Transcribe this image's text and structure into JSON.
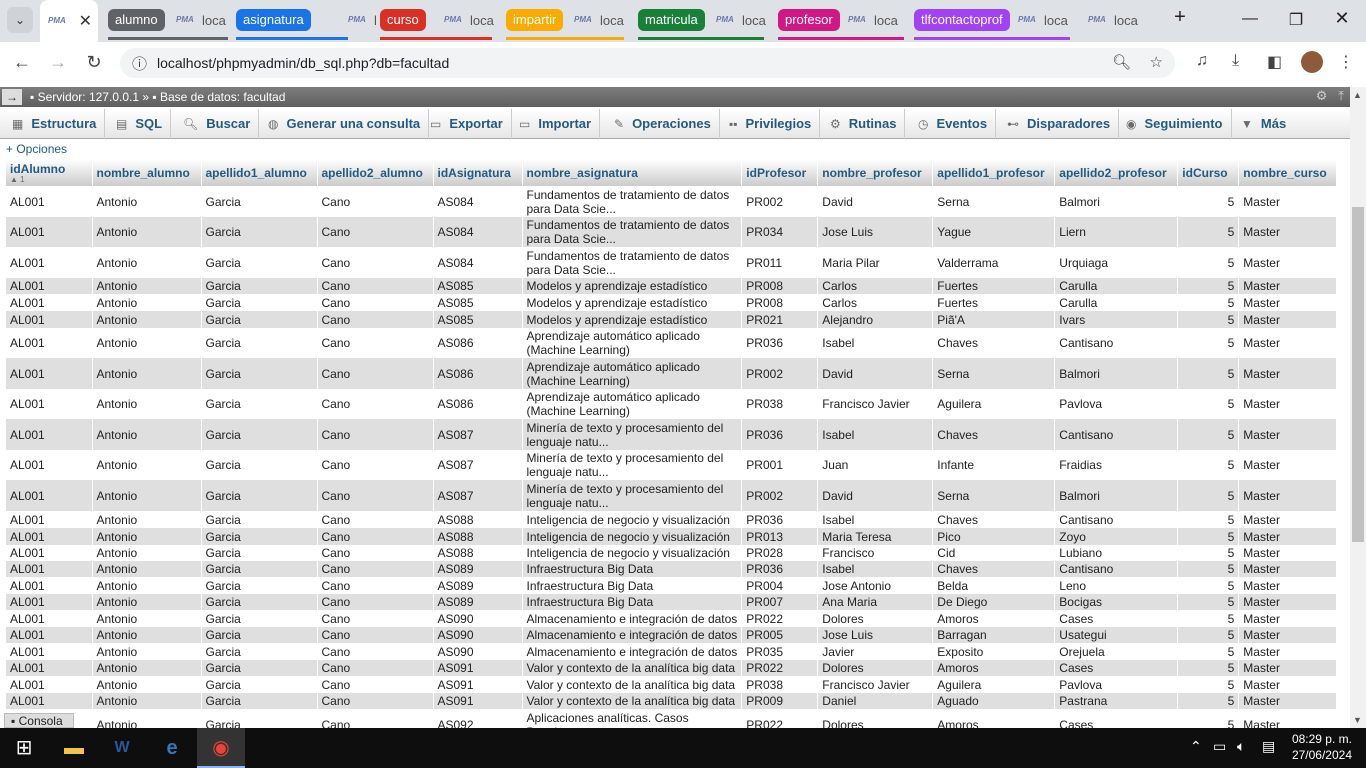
{
  "browser": {
    "tabs": [
      {
        "kind": "tab",
        "label": "",
        "active": true
      },
      {
        "kind": "group",
        "label": "alumno",
        "color": "#5f6368"
      },
      {
        "kind": "tab",
        "label": "loca"
      },
      {
        "kind": "group",
        "label": "asignatura",
        "color": "#1a73e8"
      },
      {
        "kind": "tab",
        "label": "loca"
      },
      {
        "kind": "group",
        "label": "curso",
        "color": "#d93025"
      },
      {
        "kind": "tab",
        "label": "loca"
      },
      {
        "kind": "group",
        "label": "impartir",
        "color": "#f9ab00"
      },
      {
        "kind": "tab",
        "label": "loca"
      },
      {
        "kind": "group",
        "label": "matricula",
        "color": "#188038"
      },
      {
        "kind": "tab",
        "label": "loca"
      },
      {
        "kind": "group",
        "label": "profesor",
        "color": "#d01884"
      },
      {
        "kind": "tab",
        "label": "loca"
      },
      {
        "kind": "group",
        "label": "tlfcontactoprof",
        "color": "#a142f4"
      },
      {
        "kind": "tab",
        "label": "loca"
      },
      {
        "kind": "tab",
        "label": "loca"
      }
    ],
    "favicon_text": "PMA",
    "url": "localhost/phpmyadmin/db_sql.php?db=facultad"
  },
  "pma": {
    "breadcrumb_server": "Servidor: 127.0.0.1 »",
    "breadcrumb_db": "Base de datos: facultad",
    "menu": [
      {
        "label": "Estructura",
        "icon": "structure-icon"
      },
      {
        "label": "SQL",
        "icon": "sql-icon"
      },
      {
        "label": "Buscar",
        "icon": "search-icon"
      },
      {
        "label": "Generar una consulta",
        "icon": "query-icon"
      },
      {
        "label": "Exportar",
        "icon": "export-icon"
      },
      {
        "label": "Importar",
        "icon": "import-icon"
      },
      {
        "label": "Operaciones",
        "icon": "wrench-icon"
      },
      {
        "label": "Privilegios",
        "icon": "privileges-icon"
      },
      {
        "label": "Rutinas",
        "icon": "routines-icon"
      },
      {
        "label": "Eventos",
        "icon": "clock-icon"
      },
      {
        "label": "Disparadores",
        "icon": "trigger-icon"
      },
      {
        "label": "Seguimiento",
        "icon": "eye-icon"
      },
      {
        "label": "Más",
        "icon": "chevron-down-icon"
      }
    ],
    "options_label": "+ Opciones",
    "sort_indicator": "1",
    "console_label": "Consola",
    "columns": [
      "idAlumno",
      "nombre_alumno",
      "apellido1_alumno",
      "apellido2_alumno",
      "idAsignatura",
      "nombre_asignatura",
      "idProfesor",
      "nombre_profesor",
      "apellido1_profesor",
      "apellido2_profesor",
      "idCurso",
      "nombre_curso"
    ],
    "rows": [
      [
        "AL001",
        "Antonio",
        "Garcia",
        "Cano",
        "AS084",
        "Fundamentos de tratamiento de datos para Data Scie...",
        "PR002",
        "David",
        "Serna",
        "Balmori",
        "5",
        "Master"
      ],
      [
        "AL001",
        "Antonio",
        "Garcia",
        "Cano",
        "AS084",
        "Fundamentos de tratamiento de datos para Data Scie...",
        "PR034",
        "Jose Luis",
        "Yague",
        "Liern",
        "5",
        "Master"
      ],
      [
        "AL001",
        "Antonio",
        "Garcia",
        "Cano",
        "AS084",
        "Fundamentos de tratamiento de datos para Data Scie...",
        "PR011",
        "Maria Pilar",
        "Valderrama",
        "Urquiaga",
        "5",
        "Master"
      ],
      [
        "AL001",
        "Antonio",
        "Garcia",
        "Cano",
        "AS085",
        "Modelos y aprendizaje estadístico",
        "PR008",
        "Carlos",
        "Fuertes",
        "Carulla",
        "5",
        "Master"
      ],
      [
        "AL001",
        "Antonio",
        "Garcia",
        "Cano",
        "AS085",
        "Modelos y aprendizaje estadístico",
        "PR008",
        "Carlos",
        "Fuertes",
        "Carulla",
        "5",
        "Master"
      ],
      [
        "AL001",
        "Antonio",
        "Garcia",
        "Cano",
        "AS085",
        "Modelos y aprendizaje estadístico",
        "PR021",
        "Alejandro",
        "Piã'A",
        "Ivars",
        "5",
        "Master"
      ],
      [
        "AL001",
        "Antonio",
        "Garcia",
        "Cano",
        "AS086",
        "Aprendizaje automático aplicado (Machine Learning)",
        "PR036",
        "Isabel",
        "Chaves",
        "Cantisano",
        "5",
        "Master"
      ],
      [
        "AL001",
        "Antonio",
        "Garcia",
        "Cano",
        "AS086",
        "Aprendizaje automático aplicado (Machine Learning)",
        "PR002",
        "David",
        "Serna",
        "Balmori",
        "5",
        "Master"
      ],
      [
        "AL001",
        "Antonio",
        "Garcia",
        "Cano",
        "AS086",
        "Aprendizaje automático aplicado (Machine Learning)",
        "PR038",
        "Francisco Javier",
        "Aguilera",
        "Pavlova",
        "5",
        "Master"
      ],
      [
        "AL001",
        "Antonio",
        "Garcia",
        "Cano",
        "AS087",
        "Minería de texto y procesamiento del lenguaje natu...",
        "PR036",
        "Isabel",
        "Chaves",
        "Cantisano",
        "5",
        "Master"
      ],
      [
        "AL001",
        "Antonio",
        "Garcia",
        "Cano",
        "AS087",
        "Minería de texto y procesamiento del lenguaje natu...",
        "PR001",
        "Juan",
        "Infante",
        "Fraidias",
        "5",
        "Master"
      ],
      [
        "AL001",
        "Antonio",
        "Garcia",
        "Cano",
        "AS087",
        "Minería de texto y procesamiento del lenguaje natu...",
        "PR002",
        "David",
        "Serna",
        "Balmori",
        "5",
        "Master"
      ],
      [
        "AL001",
        "Antonio",
        "Garcia",
        "Cano",
        "AS088",
        "Inteligencia de negocio y visualización",
        "PR036",
        "Isabel",
        "Chaves",
        "Cantisano",
        "5",
        "Master"
      ],
      [
        "AL001",
        "Antonio",
        "Garcia",
        "Cano",
        "AS088",
        "Inteligencia de negocio y visualización",
        "PR013",
        "Maria Teresa",
        "Pico",
        "Zoyo",
        "5",
        "Master"
      ],
      [
        "AL001",
        "Antonio",
        "Garcia",
        "Cano",
        "AS088",
        "Inteligencia de negocio y visualización",
        "PR028",
        "Francisco",
        "Cid",
        "Lubiano",
        "5",
        "Master"
      ],
      [
        "AL001",
        "Antonio",
        "Garcia",
        "Cano",
        "AS089",
        "Infraestructura Big Data",
        "PR036",
        "Isabel",
        "Chaves",
        "Cantisano",
        "5",
        "Master"
      ],
      [
        "AL001",
        "Antonio",
        "Garcia",
        "Cano",
        "AS089",
        "Infraestructura Big Data",
        "PR004",
        "Jose Antonio",
        "Belda",
        "Leno",
        "5",
        "Master"
      ],
      [
        "AL001",
        "Antonio",
        "Garcia",
        "Cano",
        "AS089",
        "Infraestructura Big Data",
        "PR007",
        "Ana Maria",
        "De Diego",
        "Bocigas",
        "5",
        "Master"
      ],
      [
        "AL001",
        "Antonio",
        "Garcia",
        "Cano",
        "AS090",
        "Almacenamiento e integración de datos",
        "PR022",
        "Dolores",
        "Amoros",
        "Cases",
        "5",
        "Master"
      ],
      [
        "AL001",
        "Antonio",
        "Garcia",
        "Cano",
        "AS090",
        "Almacenamiento e integración de datos",
        "PR005",
        "Jose Luis",
        "Barragan",
        "Usategui",
        "5",
        "Master"
      ],
      [
        "AL001",
        "Antonio",
        "Garcia",
        "Cano",
        "AS090",
        "Almacenamiento e integración de datos",
        "PR035",
        "Javier",
        "Exposito",
        "Orejuela",
        "5",
        "Master"
      ],
      [
        "AL001",
        "Antonio",
        "Garcia",
        "Cano",
        "AS091",
        "Valor y contexto de la analítica big data",
        "PR022",
        "Dolores",
        "Amoros",
        "Cases",
        "5",
        "Master"
      ],
      [
        "AL001",
        "Antonio",
        "Garcia",
        "Cano",
        "AS091",
        "Valor y contexto de la analítica big data",
        "PR038",
        "Francisco Javier",
        "Aguilera",
        "Pavlova",
        "5",
        "Master"
      ],
      [
        "AL001",
        "Antonio",
        "Garcia",
        "Cano",
        "AS091",
        "Valor y contexto de la analítica big data",
        "PR009",
        "Daniel",
        "Aguado",
        "Pastrana",
        "5",
        "Master"
      ],
      [
        "AL001",
        "Antonio",
        "Garcia",
        "Cano",
        "AS092",
        "Aplicaciones analíticas. Casos Practicos",
        "PR022",
        "Dolores",
        "Amoros",
        "Cases",
        "5",
        "Master"
      ]
    ]
  },
  "taskbar": {
    "time": "08:29 p. m.",
    "date": "27/06/2024"
  }
}
